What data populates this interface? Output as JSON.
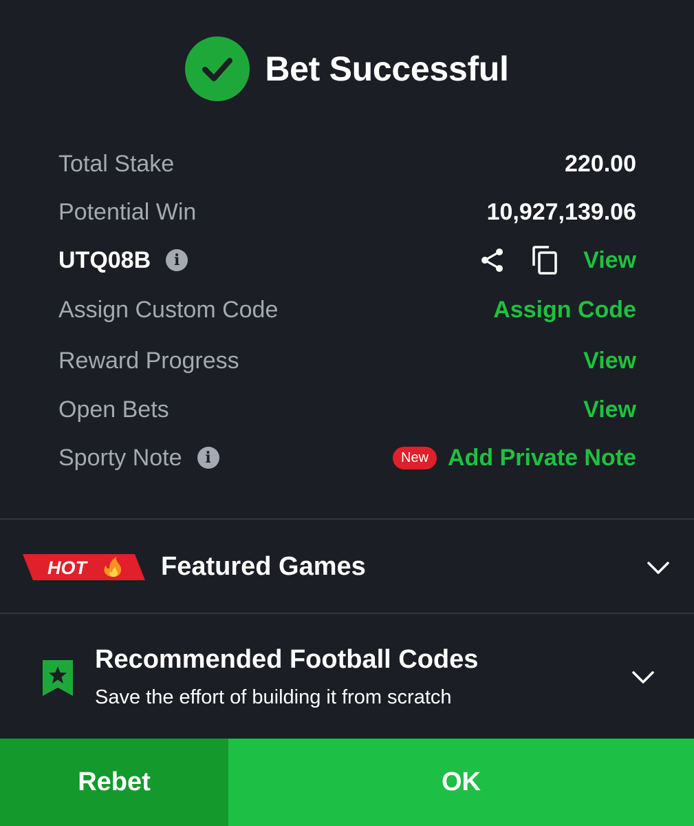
{
  "header": {
    "title": "Bet Successful",
    "icon": "check-circle-icon",
    "accent": "#1fa83a"
  },
  "summary": {
    "total_stake": {
      "label": "Total Stake",
      "value": "220.00"
    },
    "potential_win": {
      "label": "Potential Win",
      "value": "10,927,139.06"
    },
    "booking_code": {
      "code": "UTQ08B",
      "view_label": "View"
    },
    "custom_code": {
      "label": "Assign Custom Code",
      "action": "Assign Code"
    },
    "reward_progress": {
      "label": "Reward Progress",
      "action": "View"
    },
    "open_bets": {
      "label": "Open Bets",
      "action": "View"
    },
    "sporty_note": {
      "label": "Sporty Note",
      "badge": "New",
      "action": "Add Private Note"
    }
  },
  "featured": {
    "badge": "HOT",
    "title": "Featured Games"
  },
  "recommended": {
    "title": "Recommended Football Codes",
    "subtitle": "Save the effort of building it from scratch"
  },
  "footer": {
    "rebet_label": "Rebet",
    "ok_label": "OK"
  },
  "colors": {
    "background": "#1b1e24",
    "green_text": "#1ec13f",
    "ok_button": "#1dbf45",
    "rebet_button": "#149a2c",
    "badge_red": "#e0202a"
  }
}
